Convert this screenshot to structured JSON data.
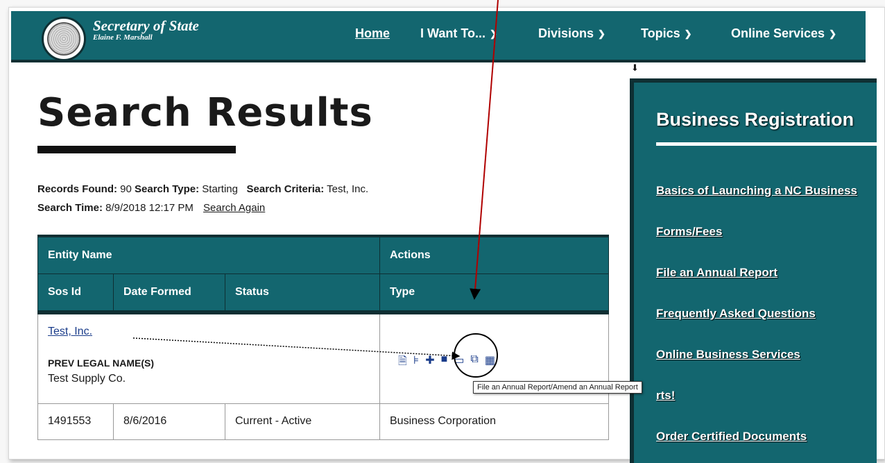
{
  "header": {
    "brand_title": "Secretary of State",
    "brand_subtitle": "Elaine F. Marshall",
    "nav": [
      {
        "label": "Home",
        "has_dropdown": false
      },
      {
        "label": "I Want To...",
        "has_dropdown": true
      },
      {
        "label": "Divisions",
        "has_dropdown": true
      },
      {
        "label": "Topics",
        "has_dropdown": true
      },
      {
        "label": "Online Services",
        "has_dropdown": true
      }
    ],
    "colors": {
      "primary": "#13666f",
      "dark": "#0e2f33"
    }
  },
  "main": {
    "title": "Search Results",
    "meta": {
      "records_label": "Records Found:",
      "records_value": "90",
      "type_label": "Search Type:",
      "type_value": "Starting",
      "criteria_label": "Search Criteria:",
      "criteria_value": "Test, Inc.",
      "time_label": "Search Time:",
      "time_value": "8/9/2018 12:17 PM",
      "search_again": "Search Again"
    },
    "table": {
      "headers_top": [
        "Entity Name",
        "Actions"
      ],
      "headers_bottom": [
        "Sos Id",
        "Date Formed",
        "Status",
        "Type"
      ],
      "entity": {
        "name": "Test, Inc.",
        "prev_label": "PREV LEGAL NAME(S)",
        "prev_value": "Test Supply Co.",
        "sos_id": "1491553",
        "date_formed": "8/6/2016",
        "status": "Current - Active",
        "type": "Business Corporation"
      }
    },
    "action_icons": [
      "document-icon",
      "filter-icon",
      "plus-icon",
      "folder-icon",
      "laptop-icon",
      "copy-icon",
      "book-icon"
    ],
    "tooltip": "File an Annual Report/Amend an Annual Report"
  },
  "sidebar": {
    "title": "Business Registration",
    "links": [
      "Basics of Launching a NC Business",
      "Forms/Fees",
      "File an Annual Report",
      "Frequently Asked Questions",
      "Online Business Services",
      "rts!",
      "Order Certified Documents"
    ]
  },
  "annotation": {
    "arrow_color": "#b00000"
  }
}
